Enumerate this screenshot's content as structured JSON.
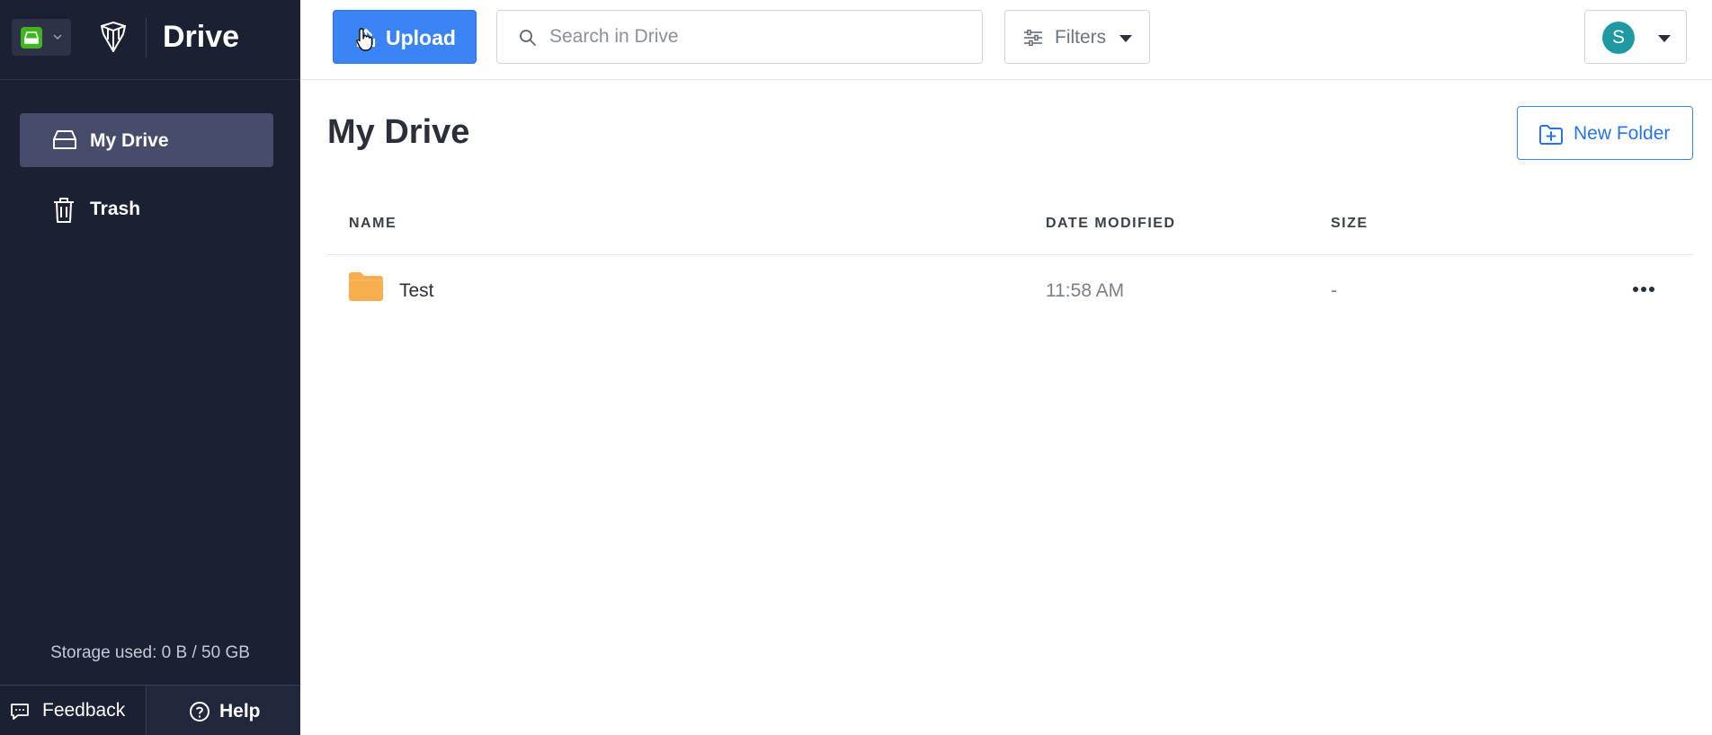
{
  "app": {
    "title": "Drive"
  },
  "sidebar": {
    "items": [
      {
        "label": "My Drive",
        "active": true,
        "icon": "drive-icon"
      },
      {
        "label": "Trash",
        "active": false,
        "icon": "trash-icon"
      }
    ],
    "storage": "Storage used: 0 B / 50 GB",
    "feedback_label": "Feedback",
    "help_label": "Help"
  },
  "toolbar": {
    "upload_label": "Upload",
    "search_placeholder": "Search in Drive",
    "filters_label": "Filters",
    "avatar_initial": "S"
  },
  "main": {
    "title": "My Drive",
    "new_folder_label": "New Folder",
    "columns": [
      "NAME",
      "DATE MODIFIED",
      "SIZE"
    ],
    "rows": [
      {
        "name": "Test",
        "type": "folder",
        "date_modified": "11:58 AM",
        "size": "-"
      }
    ]
  },
  "colors": {
    "sidebar_bg": "#1c2033",
    "active_item_bg": "#464c6a",
    "accent": "#3b84f5",
    "folder": "#f7ae4e",
    "avatar": "#1f9aa2",
    "app_switch_green": "#3fb51f"
  }
}
